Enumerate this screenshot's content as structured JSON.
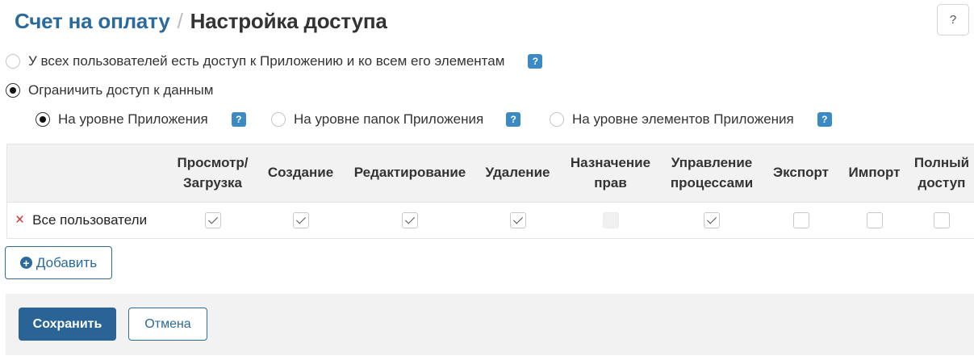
{
  "breadcrumb": {
    "parent": "Счет на оплату",
    "separator": "/",
    "current": "Настройка доступа"
  },
  "help_button": {
    "label": "?"
  },
  "access_options": {
    "all_users": {
      "label": "У всех пользователей есть доступ к Приложению и ко всем его элементам",
      "selected": false
    },
    "restrict": {
      "label": "Ограничить доступ к данным",
      "selected": true
    }
  },
  "levels": [
    {
      "label": "На уровне Приложения",
      "selected": true
    },
    {
      "label": "На уровне папок Приложения",
      "selected": false
    },
    {
      "label": "На уровне элементов Приложения",
      "selected": false
    }
  ],
  "badge_label": "?",
  "table": {
    "columns": [
      {
        "line1": "Просмотр/",
        "line2": "Загрузка"
      },
      {
        "line1": "Создание",
        "line2": ""
      },
      {
        "line1": "Редактирование",
        "line2": ""
      },
      {
        "line1": "Удаление",
        "line2": ""
      },
      {
        "line1": "Назначение",
        "line2": "прав"
      },
      {
        "line1": "Управление",
        "line2": "процессами"
      },
      {
        "line1": "Экспорт",
        "line2": ""
      },
      {
        "line1": "Импорт",
        "line2": ""
      },
      {
        "line1": "Полный",
        "line2": "доступ"
      }
    ],
    "rows": [
      {
        "user": "Все пользователи",
        "remove_icon": "×",
        "permissions": [
          "checked",
          "checked",
          "checked",
          "checked",
          "disabled",
          "checked",
          "unchecked",
          "unchecked",
          "unchecked"
        ]
      }
    ]
  },
  "add_button": {
    "icon": "+",
    "label": "Добавить"
  },
  "footer": {
    "save_label": "Сохранить",
    "cancel_label": "Отмена"
  },
  "colors": {
    "accent": "#2b6a9c",
    "badge": "#3c8ac4",
    "remove": "#d0312d",
    "footer_bg": "#f2f2f2"
  }
}
